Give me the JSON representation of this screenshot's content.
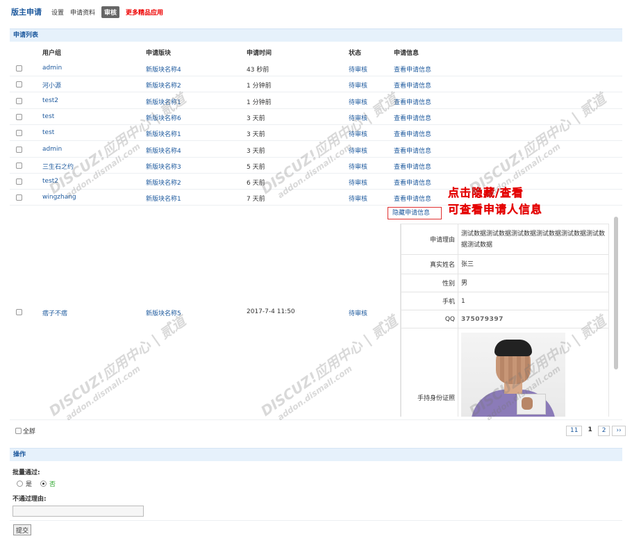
{
  "topnav": {
    "title": "版主申请",
    "items": [
      {
        "label": "设置",
        "active": false
      },
      {
        "label": "申请资料",
        "active": false
      },
      {
        "label": "审核",
        "active": true
      }
    ],
    "promo": "更多精品应用"
  },
  "list_section": {
    "title": "申请列表"
  },
  "columns": {
    "user": "用户组",
    "board": "申请版块",
    "time": "申请时间",
    "status": "状态",
    "info": "申请信息"
  },
  "rows": [
    {
      "user": "admin",
      "board": "新版块名称4",
      "time": "43 秒前",
      "status": "待审核",
      "info": "查看申请信息"
    },
    {
      "user": "河小源",
      "board": "新版块名称2",
      "time": "1 分钟前",
      "status": "待审核",
      "info": "查看申请信息"
    },
    {
      "user": "test2",
      "board": "新版块名称1",
      "time": "1 分钟前",
      "status": "待审核",
      "info": "查看申请信息"
    },
    {
      "user": "test",
      "board": "新版块名称6",
      "time": "3 天前",
      "status": "待审核",
      "info": "查看申请信息"
    },
    {
      "user": "test",
      "board": "新版块名称1",
      "time": "3 天前",
      "status": "待审核",
      "info": "查看申请信息"
    },
    {
      "user": "admin",
      "board": "新版块名称4",
      "time": "3 天前",
      "status": "待审核",
      "info": "查看申请信息"
    },
    {
      "user": "三生石之约",
      "board": "新版块名称3",
      "time": "5 天前",
      "status": "待审核",
      "info": "查看申请信息"
    },
    {
      "user": "test2",
      "board": "新版块名称2",
      "time": "6 天前",
      "status": "待审核",
      "info": "查看申请信息"
    },
    {
      "user": "wingzhang",
      "board": "新版块名称1",
      "time": "7 天前",
      "status": "待审核",
      "info": "查看申请信息"
    }
  ],
  "expanded_row": {
    "user": "痞子不痞",
    "board": "新版块名称5",
    "time": "2017-7-4 11:50",
    "status": "待审核",
    "hide_label": "隐藏申请信息",
    "details": {
      "reason_label": "申请理由",
      "reason": "测试数据测试数据测试数据测试数据测试数据测试数据测试数据",
      "name_label": "真实姓名",
      "name": "张三",
      "gender_label": "性别",
      "gender": "男",
      "phone_label": "手机",
      "phone": "1",
      "qq_label": "QQ",
      "qq": "375079397",
      "id_photo_label": "手持身份证照"
    }
  },
  "callout": {
    "line1": "点击隐藏/查看",
    "line2": "可查看申请人信息"
  },
  "select_all": "全脬",
  "pager": {
    "total": "11",
    "pages": [
      "1",
      "2"
    ],
    "next": "››"
  },
  "operation": {
    "title": "操作",
    "approve_label": "批量通过:",
    "yes": "是",
    "no": "否",
    "reject_reason_label": "不通过理由:",
    "reject_reason_value": "",
    "submit": "提交"
  },
  "watermark": {
    "line1": "DISCUZ!应用中心 | 贰道",
    "line2": "addon.dismall.com"
  },
  "colors": {
    "link": "#1e5a9e",
    "section_bg": "#e6f1fb",
    "callout": "#e40000",
    "promo": "#ee0000"
  }
}
